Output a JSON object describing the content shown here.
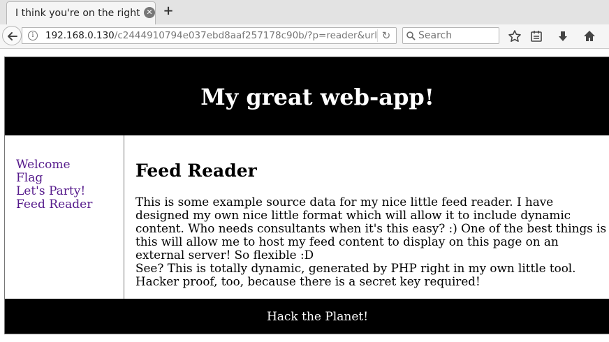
{
  "browser": {
    "tab": {
      "title": "I think you're on the right ..."
    },
    "url": {
      "host": "192.168.0.130",
      "path": "/c2444910794e037ebd8aaf257178c90b/?p=reader&url"
    },
    "search": {
      "placeholder": "Search"
    }
  },
  "page": {
    "title": "My great web-app!",
    "nav": [
      {
        "label": "Welcome"
      },
      {
        "label": "Flag"
      },
      {
        "label": "Let's Party!"
      },
      {
        "label": "Feed Reader"
      }
    ],
    "heading": "Feed Reader",
    "paragraphs": [
      "This is some example source data for my nice little feed reader. I have designed my own nice little format which will allow it to include dynamic content. Who needs consultants when it's this easy? :) One of the best things is this will allow me to host my feed content to display on this page on an external server! So flexible :D",
      "See? This is totally dynamic, generated by PHP right in my own little tool. Hacker proof, too, because there is a secret key required!"
    ],
    "footer": "Hack the Planet!"
  },
  "colors": {
    "header_bg": "#000000",
    "link": "#551a8b",
    "chrome_bg": "#f5f5f5"
  }
}
